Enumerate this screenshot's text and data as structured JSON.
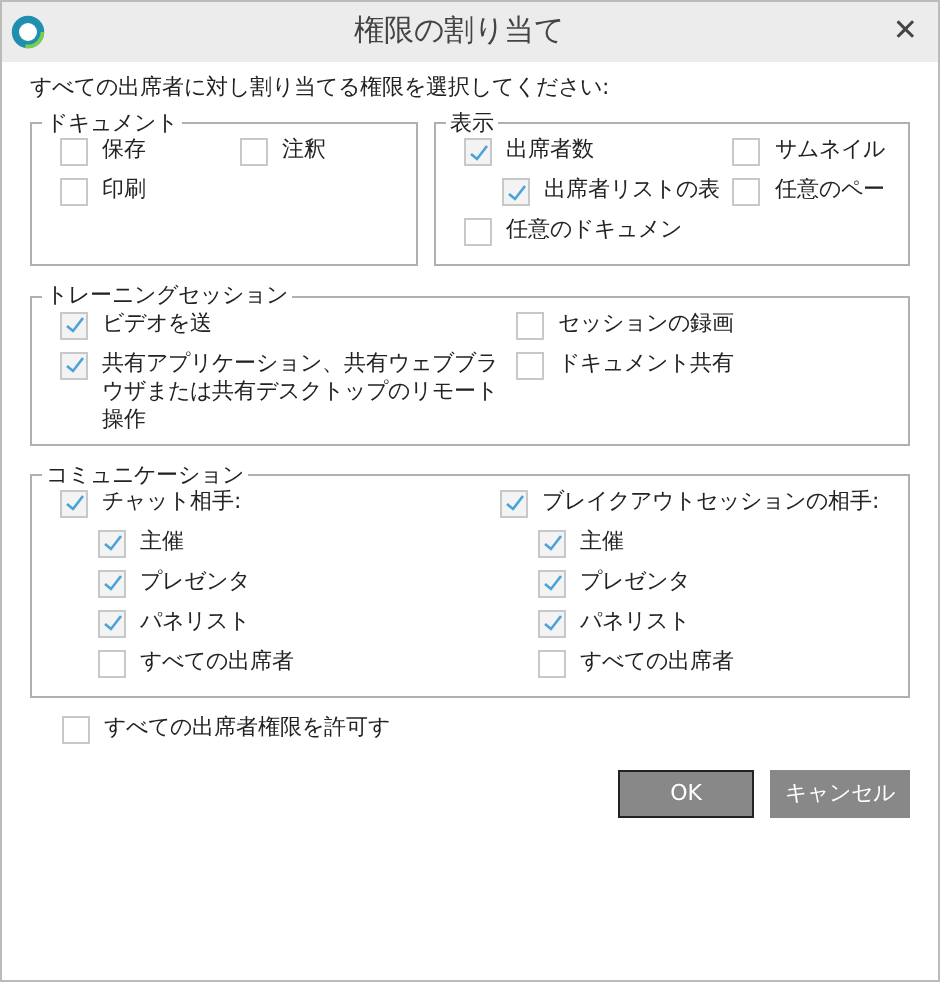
{
  "window": {
    "title": "権限の割り当て",
    "close": "✕"
  },
  "instruction": "すべての出席者に対し割り当てる権限を選択してください:",
  "groups": [
    {
      "title": "ドキュメント",
      "columns": [
        [
          {
            "label": "保存",
            "checked": false
          },
          {
            "label": "印刷",
            "checked": false
          }
        ],
        [
          {
            "label": "注釈",
            "checked": false
          }
        ]
      ]
    },
    {
      "title": "表示",
      "columns": [
        [
          {
            "label": "出席者数",
            "checked": true,
            "children": [
              {
                "label": "出席者リストの表",
                "checked": true
              }
            ]
          },
          {
            "label": "任意のドキュメン",
            "checked": false
          }
        ],
        [
          {
            "label": "サムネイル",
            "checked": false
          },
          {
            "label": "任意のペー",
            "checked": false
          }
        ]
      ]
    },
    {
      "title": "トレーニングセッション",
      "columns": [
        [
          {
            "label": "ビデオを送",
            "checked": true
          },
          {
            "label": "共有アプリケーション、共有ウェブブラウザまたは共有デスクトップのリモート操作",
            "checked": true
          }
        ],
        [
          {
            "label": "セッションの録画",
            "checked": false
          },
          {
            "label": "ドキュメント共有",
            "checked": false
          }
        ]
      ]
    },
    {
      "title": "コミュニケーション",
      "columns": [
        [
          {
            "label": "チャット相手:",
            "checked": true,
            "children": [
              {
                "label": "主催",
                "checked": true
              },
              {
                "label": "プレゼンタ",
                "checked": true
              },
              {
                "label": "パネリスト",
                "checked": true
              },
              {
                "label": "すべての出席者",
                "checked": false
              }
            ]
          }
        ],
        [
          {
            "label": "ブレイクアウトセッションの相手:",
            "checked": true,
            "children": [
              {
                "label": "主催",
                "checked": true
              },
              {
                "label": "プレゼンタ",
                "checked": true
              },
              {
                "label": "パネリスト",
                "checked": true
              },
              {
                "label": "すべての出席者",
                "checked": false
              }
            ]
          }
        ]
      ]
    }
  ],
  "allow_all": {
    "label": "すべての出席者権限を許可す",
    "checked": false
  },
  "buttons": [
    {
      "label": "OK",
      "kind": "primary"
    },
    {
      "label": "キャンセル",
      "kind": "secondary"
    }
  ]
}
